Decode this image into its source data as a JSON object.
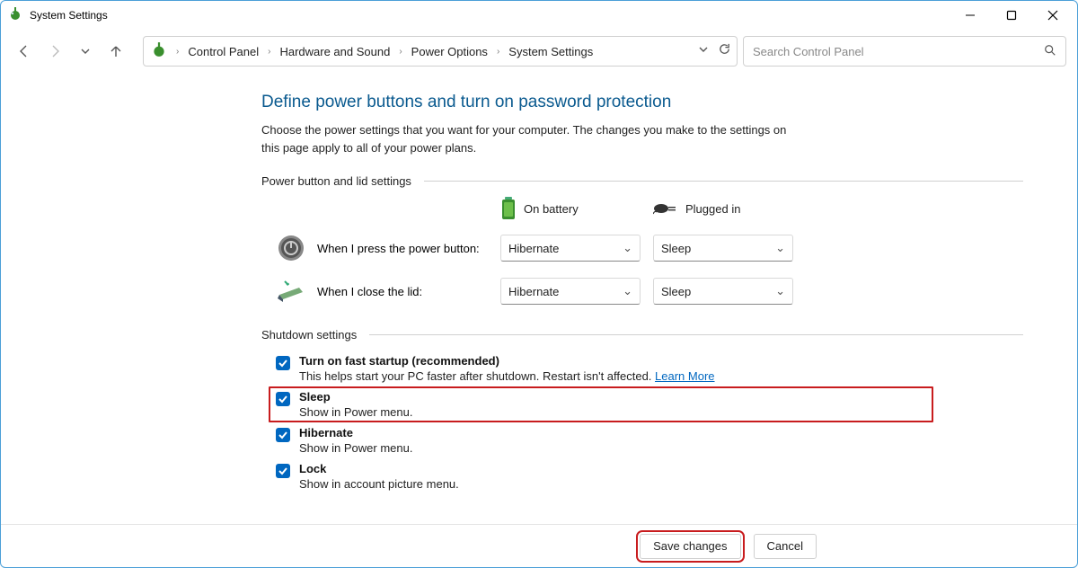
{
  "window": {
    "title": "System Settings"
  },
  "breadcrumbs": {
    "c0": "Control Panel",
    "c1": "Hardware and Sound",
    "c2": "Power Options",
    "c3": "System Settings"
  },
  "search": {
    "placeholder": "Search Control Panel"
  },
  "page": {
    "title": "Define power buttons and turn on password protection",
    "description": "Choose the power settings that you want for your computer. The changes you make to the settings on this page apply to all of your power plans."
  },
  "sections": {
    "power": {
      "heading": "Power button and lid settings",
      "col_battery": "On battery",
      "col_plugged": "Plugged in",
      "row_power_btn": "When I press the power button:",
      "row_lid": "When I close the lid:",
      "power_btn_battery": "Hibernate",
      "power_btn_plugged": "Sleep",
      "lid_battery": "Hibernate",
      "lid_plugged": "Sleep"
    },
    "shutdown": {
      "heading": "Shutdown settings",
      "items": [
        {
          "title": "Turn on fast startup (recommended)",
          "sub": "This helps start your PC faster after shutdown. Restart isn't affected. ",
          "learn": "Learn More"
        },
        {
          "title": "Sleep",
          "sub": "Show in Power menu."
        },
        {
          "title": "Hibernate",
          "sub": "Show in Power menu."
        },
        {
          "title": "Lock",
          "sub": "Show in account picture menu."
        }
      ]
    }
  },
  "footer": {
    "save": "Save changes",
    "cancel": "Cancel"
  }
}
